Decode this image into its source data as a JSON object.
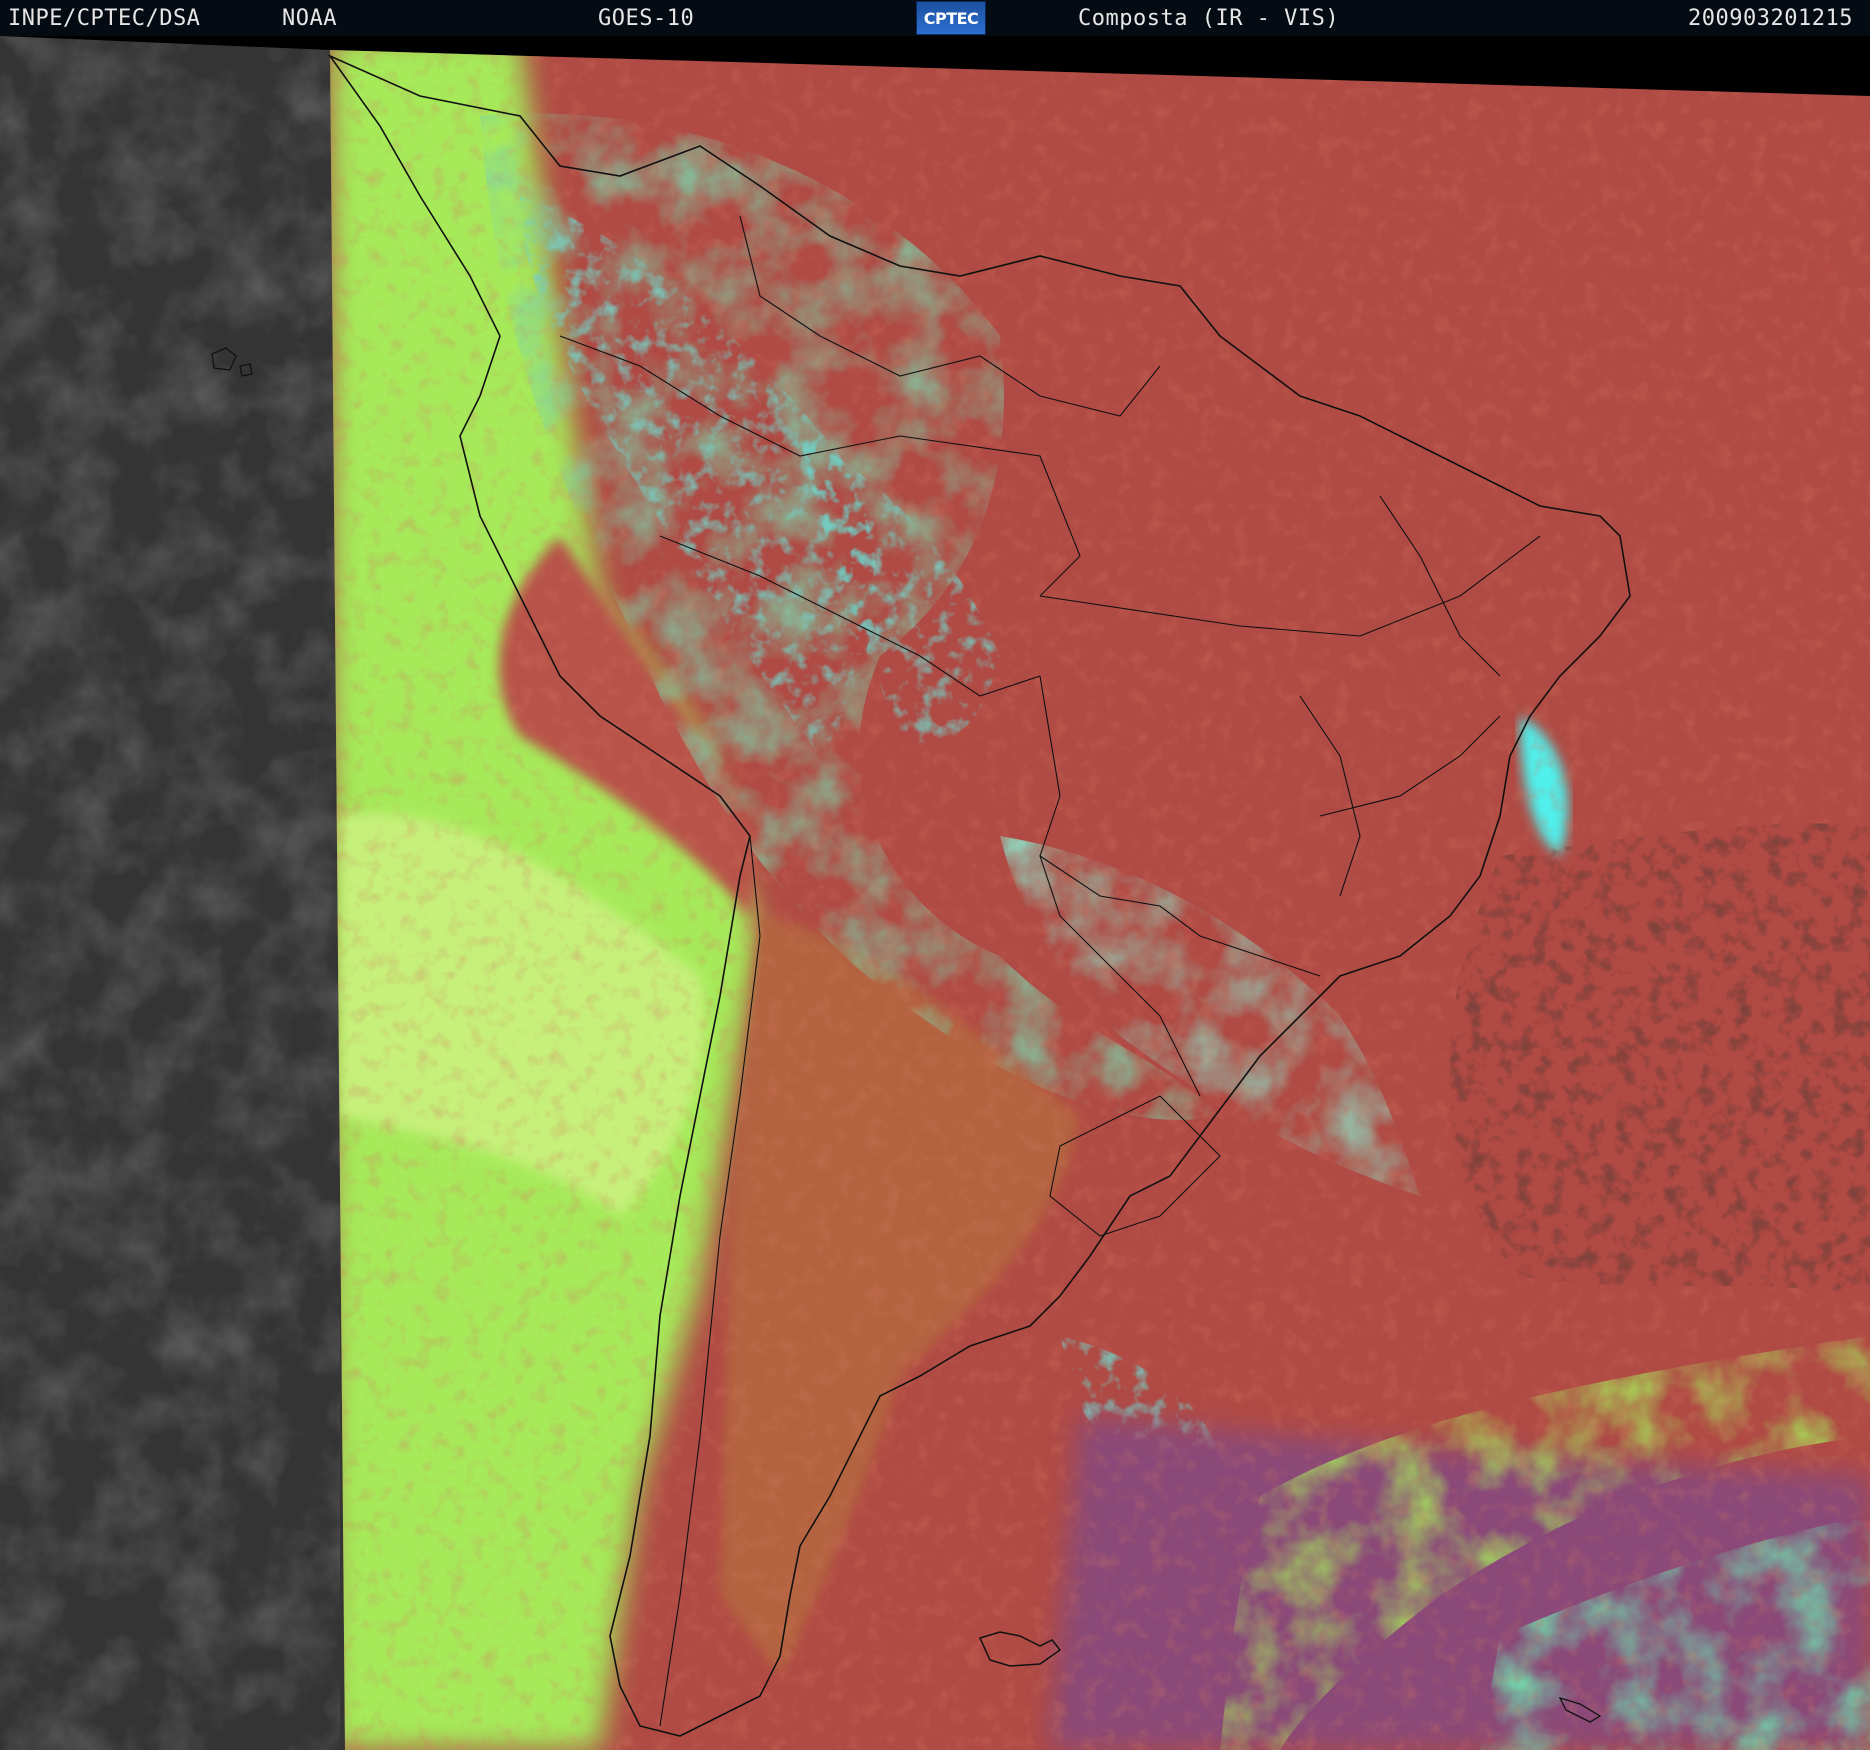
{
  "header": {
    "agency": "INPE/CPTEC/DSA",
    "provider": "NOAA",
    "satellite": "GOES-10",
    "logo_text": "CPTEC",
    "product": "Composta (IR - VIS)",
    "timestamp": "200903201215"
  },
  "colors": {
    "header_bg": "#050b12",
    "header_text": "#e6e6e6",
    "ir_gray": "#3a3a3a",
    "surface_red": "#b04a44",
    "land_orange": "#b46440",
    "low_cloud_green": "#a6ea5a",
    "high_cloud_cyan": "#4ff0ec",
    "mid_cloud_blue": "#8a86c8",
    "ocean_purple": "#8a4a78",
    "border_lines": "#111111"
  }
}
